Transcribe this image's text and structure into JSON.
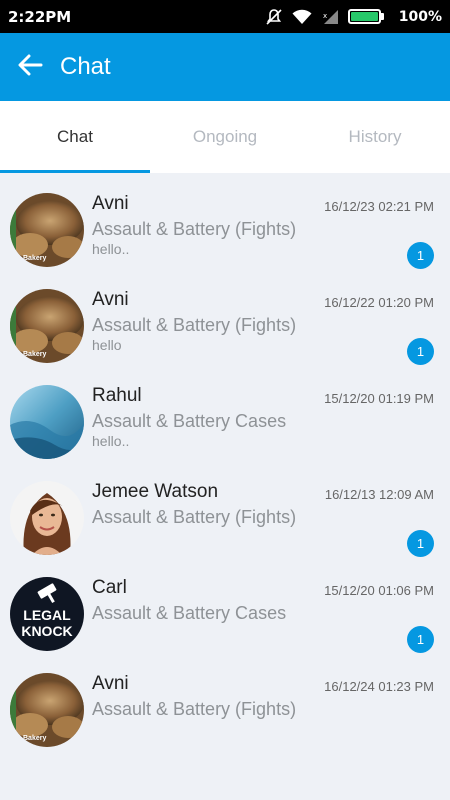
{
  "status_bar": {
    "time": "2:22PM",
    "battery_percent": "100%",
    "icons": [
      "mute-icon",
      "wifi-icon",
      "signal-icon",
      "battery-icon"
    ]
  },
  "app_bar": {
    "title": "Chat",
    "back_icon": "arrow-left-icon",
    "color": "#0598e1"
  },
  "tabs": [
    {
      "label": "Chat",
      "active": true
    },
    {
      "label": "Ongoing",
      "active": false
    },
    {
      "label": "History",
      "active": false
    }
  ],
  "chats": [
    {
      "name": "Avni",
      "date": "16/12/23 02:21 PM",
      "subject": "Assault & Battery (Fights)",
      "preview": "hello..",
      "unread": "1",
      "avatar": "bakery-avatar",
      "avatar_text": "Bakery"
    },
    {
      "name": "Avni",
      "date": "16/12/22 01:20 PM",
      "subject": "Assault & Battery (Fights)",
      "preview": "hello",
      "unread": "1",
      "avatar": "bakery-avatar",
      "avatar_text": "Bakery"
    },
    {
      "name": "Rahul",
      "date": "15/12/20 01:19 PM",
      "subject": "Assault & Battery Cases",
      "preview": "hello..",
      "unread": null,
      "avatar": "blue-wallpaper-avatar",
      "avatar_text": ""
    },
    {
      "name": "Jemee Watson",
      "date": "16/12/13 12:09 AM",
      "subject": "Assault & Battery (Fights)",
      "preview": "",
      "unread": "1",
      "avatar": "woman-portrait-avatar",
      "avatar_text": ""
    },
    {
      "name": "Carl",
      "date": "15/12/20 01:06 PM",
      "subject": "Assault & Battery Cases",
      "preview": "",
      "unread": "1",
      "avatar": "legal-knock-avatar",
      "avatar_text": "LEGAL KNOCK"
    },
    {
      "name": "Avni",
      "date": "16/12/24 01:23 PM",
      "subject": "Assault & Battery (Fights)",
      "preview": "",
      "unread": null,
      "avatar": "bakery-avatar",
      "avatar_text": "Bakery"
    }
  ]
}
